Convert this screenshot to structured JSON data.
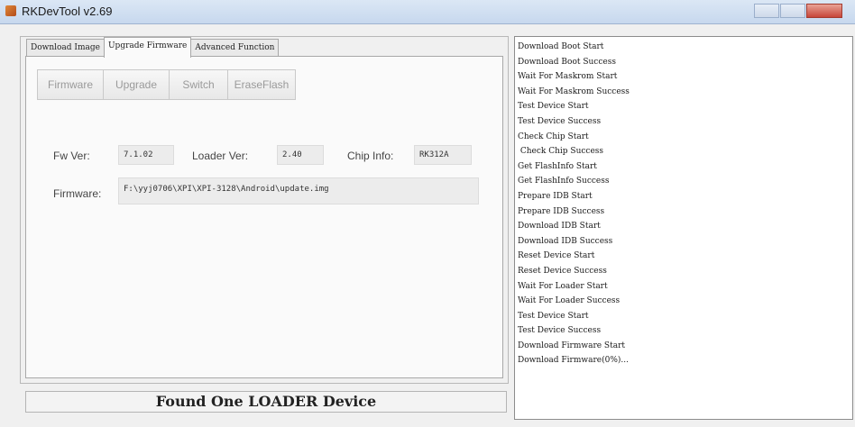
{
  "window": {
    "title": "RKDevTool v2.69"
  },
  "tabs": [
    {
      "label": "Download Image"
    },
    {
      "label": "Upgrade Firmware"
    },
    {
      "label": "Advanced Function"
    }
  ],
  "buttons": {
    "firmware": "Firmware",
    "upgrade": "Upgrade",
    "switch": "Switch",
    "erase_flash": "EraseFlash"
  },
  "info": {
    "fw_ver_label": "Fw Ver:",
    "fw_ver_value": "7.1.02",
    "loader_ver_label": "Loader Ver:",
    "loader_ver_value": "2.40",
    "chip_info_label": "Chip Info:",
    "chip_info_value": "RK312A",
    "firmware_label": "Firmware:",
    "firmware_path": "F:\\yyj0706\\XPI\\XPI-3128\\Android\\update.img"
  },
  "status": {
    "text": "Found One LOADER Device"
  },
  "log": [
    "Download Boot Start",
    "Download Boot Success",
    "Wait For Maskrom Start",
    "Wait For Maskrom Success",
    "Test Device Start",
    "Test Device Success",
    "Check Chip Start",
    " Check Chip Success",
    "Get FlashInfo Start",
    "Get FlashInfo Success",
    "Prepare IDB Start",
    "Prepare IDB Success",
    "Download IDB Start",
    "Download IDB Success",
    "Reset Device Start",
    "Reset Device Success",
    "Wait For Loader Start",
    "Wait For Loader Success",
    "Test Device Start",
    "Test Device Success",
    "Download Firmware Start",
    "Download Firmware(0%)..."
  ]
}
